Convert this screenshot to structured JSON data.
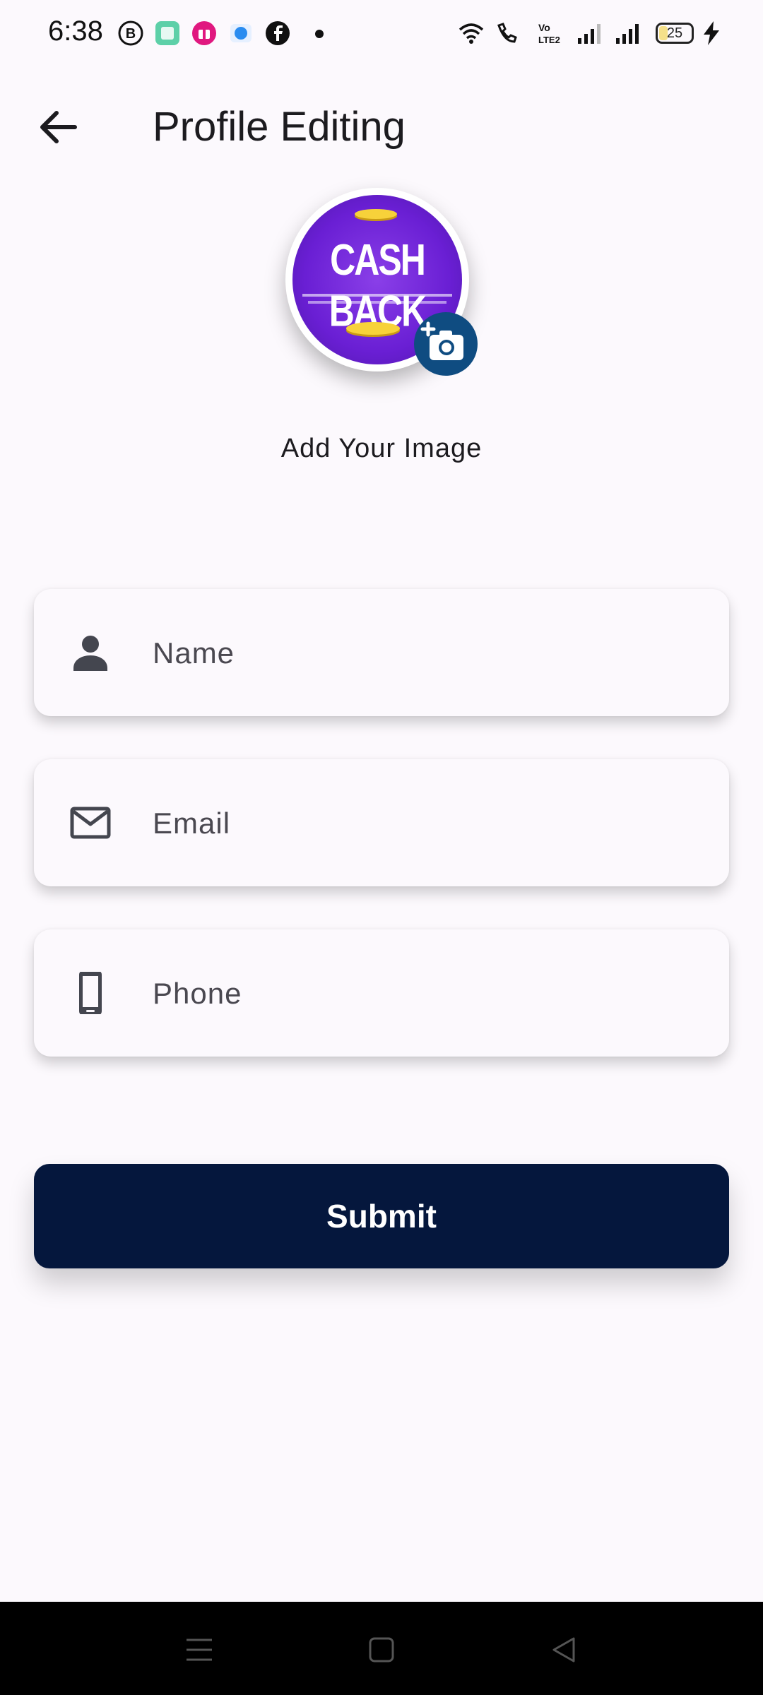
{
  "status_bar": {
    "time": "6:38",
    "battery": "25",
    "icons": [
      "b-badge-icon",
      "app-square-icon",
      "gift-app-icon",
      "blue-app-icon",
      "facebook-icon",
      "dot-icon",
      "wifi-icon",
      "wifi-call-icon",
      "volte-icon",
      "signal-icon",
      "signal-icon",
      "battery-icon",
      "charging-icon"
    ]
  },
  "app_bar": {
    "title": "Profile Editing",
    "back_icon": "arrow-back-icon"
  },
  "avatar": {
    "image_text": "CASH BACK",
    "add_photo_icon": "add-photo-camera-icon",
    "label": "Add Your Image"
  },
  "form": {
    "name": {
      "placeholder": "Name",
      "value": "",
      "icon": "person-icon"
    },
    "email": {
      "placeholder": "Email",
      "value": "",
      "icon": "mail-icon"
    },
    "phone": {
      "placeholder": "Phone",
      "value": "",
      "icon": "phone-icon"
    }
  },
  "submit": {
    "label": "Submit"
  },
  "nav_bar": {
    "icons": [
      "menu-icon",
      "home-square-icon",
      "back-triangle-icon"
    ]
  },
  "colors": {
    "background": "#fcf9fd",
    "primary_button": "#05173d",
    "camera_badge": "#0f4c81",
    "avatar_purple": "#6a1fd4"
  }
}
